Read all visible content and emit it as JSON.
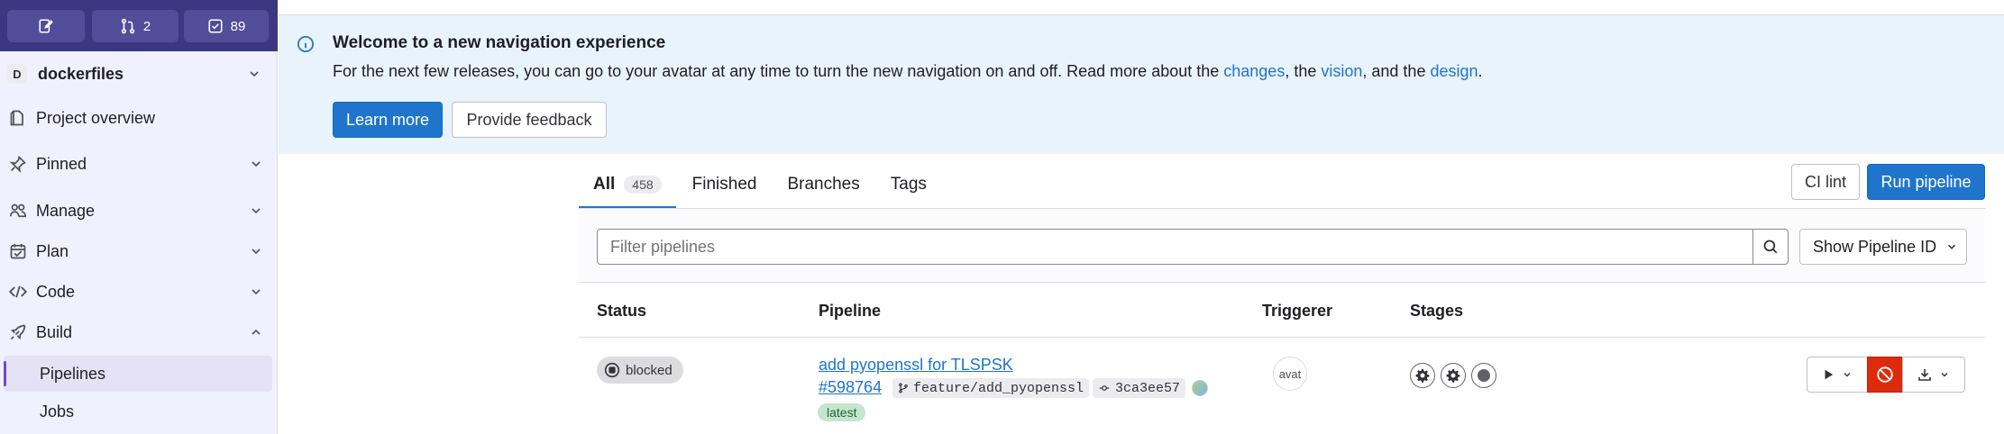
{
  "topbar": {
    "mr_count": "2",
    "todo_count": "89"
  },
  "project": {
    "avatar_letter": "D",
    "name": "dockerfiles"
  },
  "nav": {
    "overview": "Project overview",
    "pinned": "Pinned",
    "manage": "Manage",
    "plan": "Plan",
    "code": "Code",
    "build": "Build",
    "pipelines": "Pipelines",
    "jobs": "Jobs"
  },
  "banner": {
    "title": "Welcome to a new navigation experience",
    "text_before": "For the next few releases, you can go to your avatar at any time to turn the new navigation on and off. Read more about the ",
    "link_changes": "changes",
    "text_mid1": ", the ",
    "link_vision": "vision",
    "text_mid2": ", and the ",
    "link_design": "design",
    "text_end": ".",
    "learn_more": "Learn more",
    "feedback": "Provide feedback"
  },
  "tabs": {
    "all": "All",
    "all_count": "458",
    "finished": "Finished",
    "branches": "Branches",
    "tags": "Tags"
  },
  "actions": {
    "ci_lint": "CI lint",
    "run_pipeline": "Run pipeline"
  },
  "filter": {
    "placeholder": "Filter pipelines",
    "show_id": "Show Pipeline ID"
  },
  "table": {
    "headers": {
      "status": "Status",
      "pipeline": "Pipeline",
      "triggerer": "Triggerer",
      "stages": "Stages"
    },
    "rows": [
      {
        "status": "blocked",
        "title": "add pyopenssl for TLSPSK",
        "id": "#598764",
        "branch": "feature/add_pyopenssl",
        "commit": "3ca3ee57",
        "tag": "latest",
        "avatar_alt": "avat"
      }
    ]
  },
  "colors": {
    "accent": "#1f75cb",
    "sidebar_top": "#3b3780",
    "danger": "#dd2b0e"
  }
}
